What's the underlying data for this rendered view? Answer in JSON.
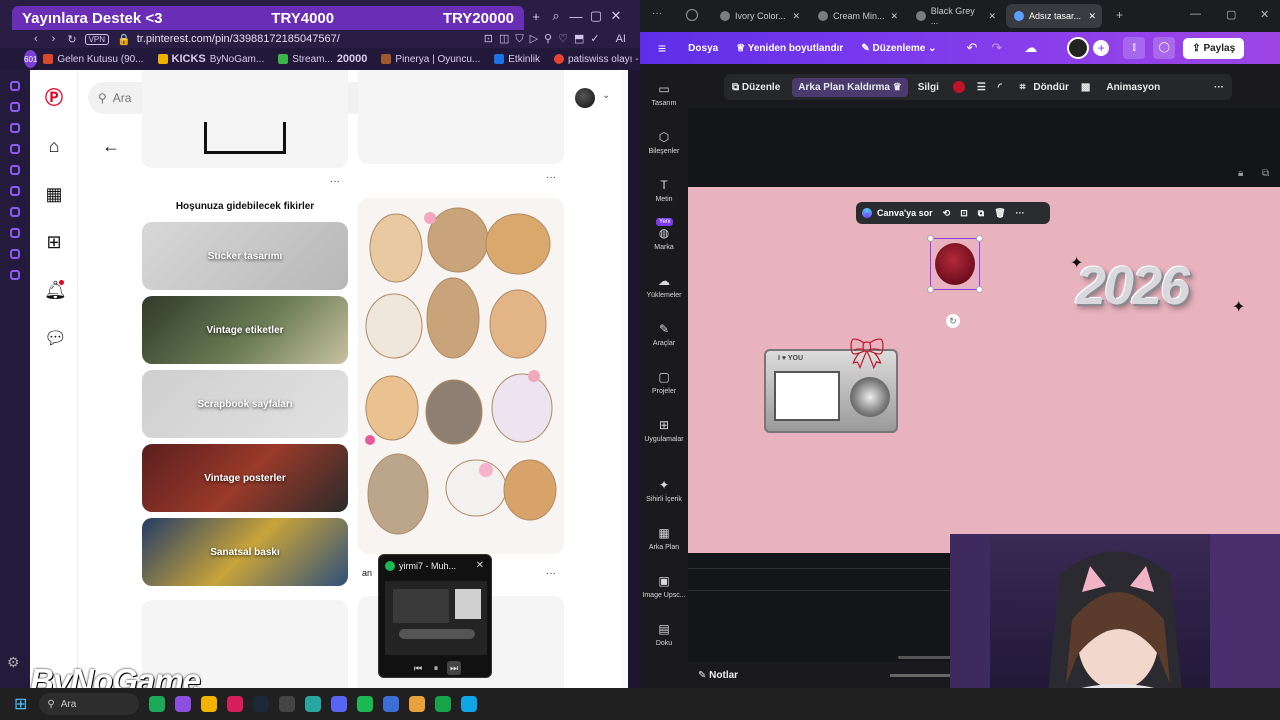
{
  "left_browser": {
    "banner": {
      "text_left": "Yayınlara Destek",
      "text_heart": "<3",
      "amount_1": "TRY4000",
      "amount_2": "TRY20000"
    },
    "url": "tr.pinterest.com/pin/33988172185047567/",
    "vpn": "VPN",
    "ai_label": "AI",
    "bookmarks": [
      {
        "label": "Gelen Kutusu (90...",
        "color": "#d9482b"
      },
      {
        "label": "ByNoGam...",
        "color": "#f0b000"
      },
      {
        "label": "Stream...",
        "color": "#3ab54a"
      },
      {
        "label": "Pinerya | Oyuncu...",
        "color": "#a05a2c"
      },
      {
        "label": "Etkinlik",
        "color": "#1a73e8"
      },
      {
        "label": "patiswiss olayı - G...",
        "color": "#ea4335"
      }
    ],
    "kicks_overlay": "KICKS",
    "stream_overlay": "20000",
    "notif_count": "601"
  },
  "pinterest": {
    "search_placeholder": "Ara",
    "ideas_heading": "Hoşunuza gidebilecek fikirler",
    "ideas": [
      {
        "label": "Sticker tasarımı",
        "bg": "linear-gradient(135deg,#d8d8d8,#b7b7b7)"
      },
      {
        "label": "Vintage etiketler",
        "bg": "linear-gradient(135deg,#2f3a2a,#6b7d55 55%,#c8c2a0)"
      },
      {
        "label": "Scrapbook sayfaları",
        "bg": "linear-gradient(135deg,#cfcfcf,#e2e2e2)"
      },
      {
        "label": "Vintage posterler",
        "bg": "linear-gradient(135deg,#5a1e1e,#9a3a2a 50%,#2a2a2a)"
      },
      {
        "label": "Sanatsal baskı",
        "bg": "linear-gradient(135deg,#233c66,#c8a43a 50%,#2f4f7a)"
      }
    ],
    "truncated_caption": "an"
  },
  "spotify": {
    "title": "yirmi7 - Muh..."
  },
  "watermark": "ByNoGame",
  "canva": {
    "tabs": [
      "Ivory Color...",
      "Cream Min...",
      "Black Grey ...",
      "Adsız tasar..."
    ],
    "header": {
      "file": "Dosya",
      "resize": "Yeniden boyutlandır",
      "edit_mode": "Düzenleme",
      "share": "Paylaş"
    },
    "toolbar": {
      "edit": "Düzenle",
      "bg_remove": "Arka Plan Kaldırma",
      "erase": "Silgi",
      "rotate": "Döndür",
      "animate": "Animasyon",
      "accent_color": "#c0132a"
    },
    "rail": [
      {
        "label": "Tasarım",
        "glyph": "▭"
      },
      {
        "label": "Bileşenler",
        "glyph": "⬡"
      },
      {
        "label": "Metin",
        "glyph": "T"
      },
      {
        "label": "Marka",
        "glyph": "◍",
        "badge": "Yeni"
      },
      {
        "label": "Yüklemeler",
        "glyph": "☁"
      },
      {
        "label": "Araçlar",
        "glyph": "✎"
      },
      {
        "label": "Projeler",
        "glyph": "▢"
      },
      {
        "label": "Uygulamalar",
        "glyph": "⊞"
      },
      {
        "label": "Sihirli İçerik",
        "glyph": "✦"
      },
      {
        "label": "Arka Plan",
        "glyph": "▦"
      },
      {
        "label": "Image Upsc...",
        "glyph": "▣"
      },
      {
        "label": "Doku",
        "glyph": "▤"
      }
    ],
    "elem_toolbar": {
      "ask": "Canva'ya sor"
    },
    "design": {
      "year_text": "2026",
      "camera_label": "I ♥ YOU"
    },
    "notes": "Notlar"
  },
  "taskbar": {
    "search": "Ara"
  }
}
